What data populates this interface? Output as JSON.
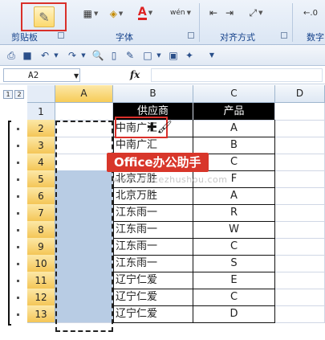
{
  "ribbon": {
    "groups": [
      {
        "label": "剪贴板"
      },
      {
        "label": "字体"
      },
      {
        "label": "对齐方式"
      },
      {
        "label": "数字"
      }
    ],
    "font_color_letter": "A",
    "decimal_label": "←.0",
    "wen_glyph": "wén"
  },
  "formula_bar": {
    "name_box": "A2",
    "fx_label": "fx",
    "formula_value": ""
  },
  "outline": {
    "levels": [
      "1",
      "2"
    ]
  },
  "columns": [
    "A",
    "B",
    "C",
    "D"
  ],
  "rows": [
    "1",
    "2",
    "3",
    "4",
    "5",
    "6",
    "7",
    "8",
    "9",
    "10",
    "11",
    "12",
    "13"
  ],
  "table": {
    "header": {
      "supplier": "供应商",
      "product": "产品"
    },
    "rows": [
      {
        "supplier": "中南广汇",
        "product": "A"
      },
      {
        "supplier": "中南广汇",
        "product": "B"
      },
      {
        "supplier": "",
        "product": "C"
      },
      {
        "supplier": "北京万胜",
        "product": "F"
      },
      {
        "supplier": "北京万胜",
        "product": "A"
      },
      {
        "supplier": "江东雨一",
        "product": "R"
      },
      {
        "supplier": "江东雨一",
        "product": "W"
      },
      {
        "supplier": "江东雨一",
        "product": "C"
      },
      {
        "supplier": "江东雨一",
        "product": "S"
      },
      {
        "supplier": "辽宁仁爱",
        "product": "E"
      },
      {
        "supplier": "辽宁仁爱",
        "product": "C"
      },
      {
        "supplier": "辽宁仁爱",
        "product": "D"
      }
    ]
  },
  "watermark": {
    "title": "Office办公助手",
    "url": "www.officezhushou.com"
  },
  "colors": {
    "highlight_red": "#d9302a",
    "selection_blue": "#b8cce4",
    "header_black": "#000000",
    "row_header_selected": "#f7cc58"
  }
}
